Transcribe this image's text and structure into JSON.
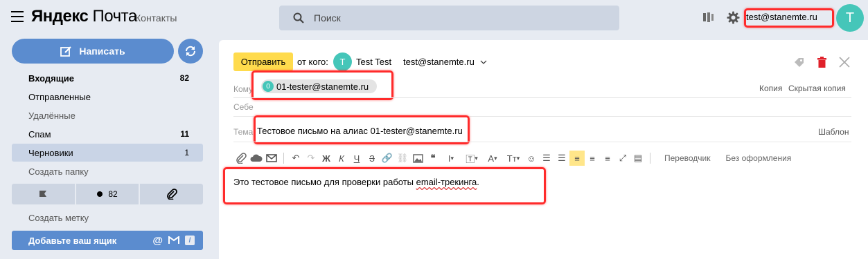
{
  "header": {
    "logo_brand": "Яндекс",
    "logo_product": "Почта",
    "contacts": "Контакты",
    "search_placeholder": "Поиск",
    "user_email": "test@stanemte.ru",
    "avatar_letter": "T"
  },
  "sidebar": {
    "compose_label": "Написать",
    "folders": [
      {
        "name": "Входящие",
        "count": "82"
      },
      {
        "name": "Отправленные",
        "count": ""
      },
      {
        "name": "Удалённые",
        "count": ""
      },
      {
        "name": "Спам",
        "count": "11"
      },
      {
        "name": "Черновики",
        "count": "1"
      }
    ],
    "create_folder": "Создать папку",
    "labels": {
      "unread_count": "82"
    },
    "create_label": "Создать метку",
    "add_mailbox": "Добавьте ваш ящик"
  },
  "compose": {
    "send_label": "Отправить",
    "from_label": "от кого:",
    "from_avatar": "T",
    "from_name": "Test Test",
    "from_email": "test@stanemte.ru",
    "to_label": "Кому",
    "to_chip_avatar": "0",
    "to_chip_email": "01-tester@stanemte.ru",
    "cc_link": "Копия",
    "bcc_link": "Скрытая копия",
    "self_label": "Себе",
    "subject_label": "Тема",
    "subject_value": "Тестовое письмо на алиас 01-tester@stanemte.ru",
    "template_link": "Шаблон",
    "translator": "Переводчик",
    "no_format": "Без оформления",
    "body_before": "Это тестовое письмо для проверки работы ",
    "body_underlined": "email-трекинга",
    "body_after": "."
  }
}
